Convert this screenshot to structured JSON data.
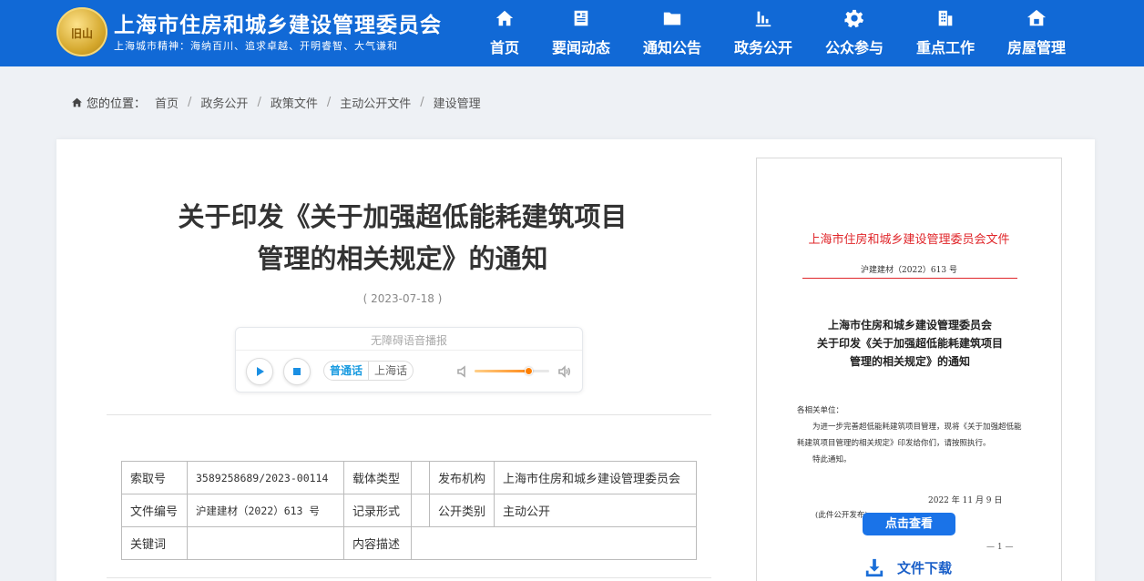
{
  "header": {
    "logo_text": "旧山",
    "site_title": "上海市住房和城乡建设管理委员会",
    "motto": "上海城市精神：海纳百川、追求卓越、开明睿智、大气谦和",
    "nav": [
      {
        "label": "首页",
        "icon": "home-icon"
      },
      {
        "label": "要闻动态",
        "icon": "news-icon"
      },
      {
        "label": "通知公告",
        "icon": "folder-icon"
      },
      {
        "label": "政务公开",
        "icon": "chart-icon"
      },
      {
        "label": "公众参与",
        "icon": "gear-icon"
      },
      {
        "label": "重点工作",
        "icon": "building-icon"
      },
      {
        "label": "房屋管理",
        "icon": "house-icon"
      }
    ]
  },
  "breadcrumb": {
    "prefix": "您的位置：",
    "items": [
      "首页",
      "政务公开",
      "政策文件",
      "主动公开文件",
      "建设管理"
    ]
  },
  "article": {
    "title_line1": "关于印发《关于加强超低能耗建筑项目",
    "title_line2": "管理的相关规定》的通知",
    "date": "( 2023-07-18 )"
  },
  "player": {
    "title": "无障碍语音播报",
    "lang_active": "普通话",
    "lang_other": "上海话",
    "volume": 0.72
  },
  "meta": {
    "rows": [
      [
        "索取号",
        "3589258689/2023-00114",
        "载体类型",
        "",
        "发布机构",
        "上海市住房和城乡建设管理委员会"
      ],
      [
        "文件编号",
        "沪建建材（2022）613 号",
        "记录形式",
        "",
        "公开类别",
        "主动公开"
      ],
      [
        "关键词",
        "",
        "内容描述",
        "",
        "",
        ""
      ]
    ]
  },
  "doc": {
    "head": "上海市住房和城乡建设管理委员会文件",
    "number": "沪建建材（2022）613 号",
    "title_lines": [
      "上海市住房和城乡建设管理委员会",
      "关于印发《关于加强超低能耗建筑项目",
      "管理的相关规定》的通知"
    ],
    "salutation": "各相关单位：",
    "body": "为进一步完善超低能耗建筑项目管理，现将《关于加强超低能耗建筑项目管理的相关规定》印发给你们，请按照执行。",
    "closing": "特此通知。",
    "date": "2022 年 11 月 9 日",
    "footnote": "(此件公开发布)",
    "page": "— 1 —",
    "view_label": "点击查看",
    "download_label": "文件下载"
  }
}
